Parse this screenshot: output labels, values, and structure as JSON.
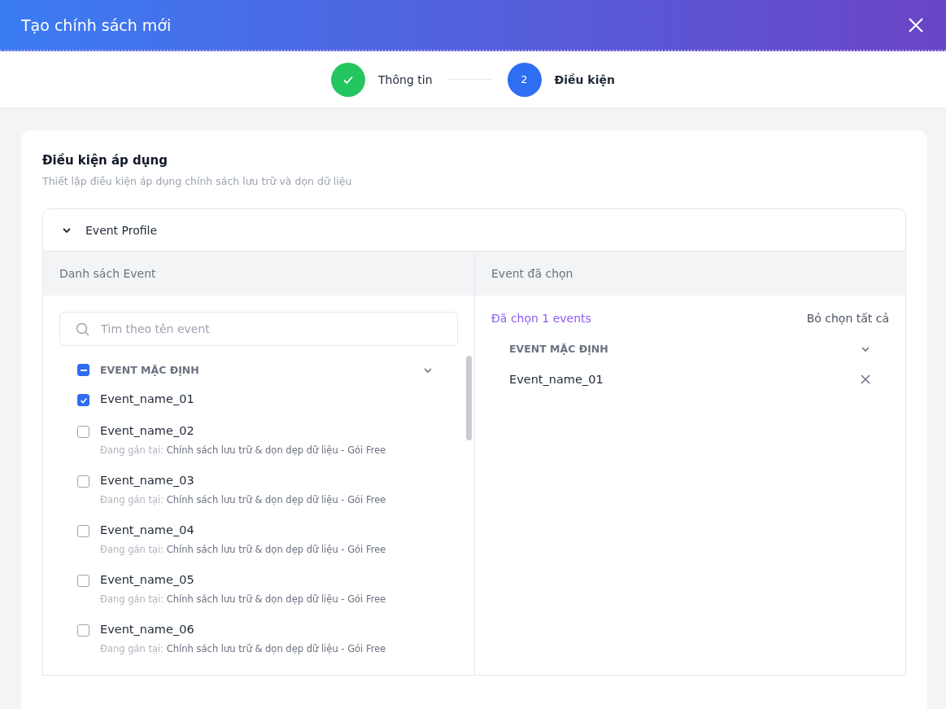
{
  "dialog": {
    "title": "Tạo chính sách mới"
  },
  "steps": [
    {
      "label": "Thông tin",
      "completed": true,
      "selected": false
    },
    {
      "label": "Điều kiện",
      "number": "2",
      "completed": false,
      "selected": true
    }
  ],
  "section": {
    "title": "Điều kiện áp dụng",
    "subtitle": "Thiết lập điều kiện áp dụng chính sách lưu trữ và dọn dữ liệu"
  },
  "panel": {
    "title": "Event Profile",
    "expanded": true
  },
  "left": {
    "heading": "Danh sách Event",
    "search": {
      "placeholder": "Tìm theo tên event"
    },
    "group": {
      "label": "EVENT MẶC ĐỊNH",
      "partial": true,
      "expanded": false
    },
    "events": [
      {
        "name": "Event_name_01",
        "checked": true
      },
      {
        "name": "Event_name_02",
        "checked": false,
        "assigned_label": "Đang gán tại:",
        "assigned_to": "Chính sách lưu trữ & dọn dẹp dữ liệu - Gói Free"
      },
      {
        "name": "Event_name_03",
        "checked": false,
        "assigned_label": "Đang gán tại:",
        "assigned_to": "Chính sách lưu trữ & dọn dẹp dữ liệu - Gói Free"
      },
      {
        "name": "Event_name_04",
        "checked": false,
        "assigned_label": "Đang gán tại:",
        "assigned_to": "Chính sách lưu trữ & dọn dẹp dữ liệu - Gói Free"
      },
      {
        "name": "Event_name_05",
        "checked": false,
        "assigned_label": "Đang gán tại:",
        "assigned_to": "Chính sách lưu trữ & dọn dẹp dữ liệu - Gói Free"
      },
      {
        "name": "Event_name_06",
        "checked": false,
        "assigned_label": "Đang gán tại:",
        "assigned_to": "Chính sách lưu trữ & dọn dẹp dữ liệu - Gói Free"
      }
    ]
  },
  "right": {
    "heading": "Event đã chọn",
    "count": "Đã chọn 1 events",
    "clear": "Bỏ chọn tất cả",
    "group": {
      "label": "EVENT MẶC ĐỊNH",
      "expanded": false
    },
    "selected_events": [
      {
        "name": "Event_name_01"
      }
    ]
  }
}
